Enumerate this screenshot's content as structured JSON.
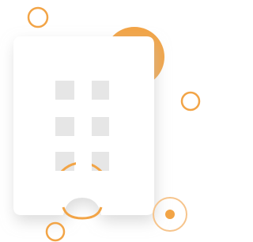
{
  "illustration": {
    "subject": "building-icon",
    "colors": {
      "accent": "#f2a446",
      "accent_light": "#f6c48c",
      "building": "#ffffff",
      "window": "#e6e6e6",
      "shadow": "#bfbfbf"
    },
    "window_rows": 3,
    "window_columns": 2
  }
}
